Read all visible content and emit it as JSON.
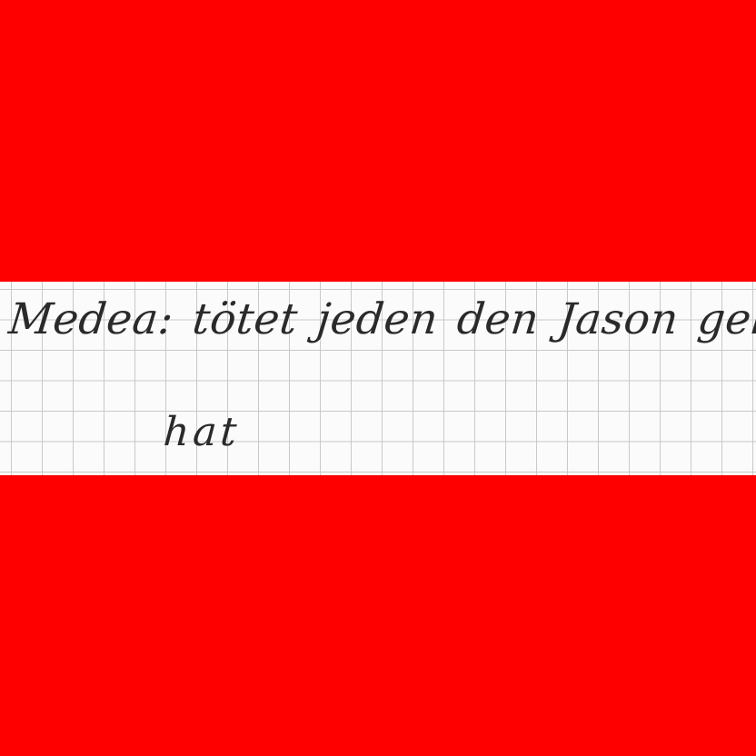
{
  "sheet": {
    "background_color": "#ff0000",
    "paper_color": "#fbfbfb",
    "grid_color": "#c9c9c9",
    "ink_color": "#2a2a2a"
  },
  "handwriting": {
    "line1": "Medea: tötet jeden den Jason geliebt",
    "line2": "hat"
  }
}
